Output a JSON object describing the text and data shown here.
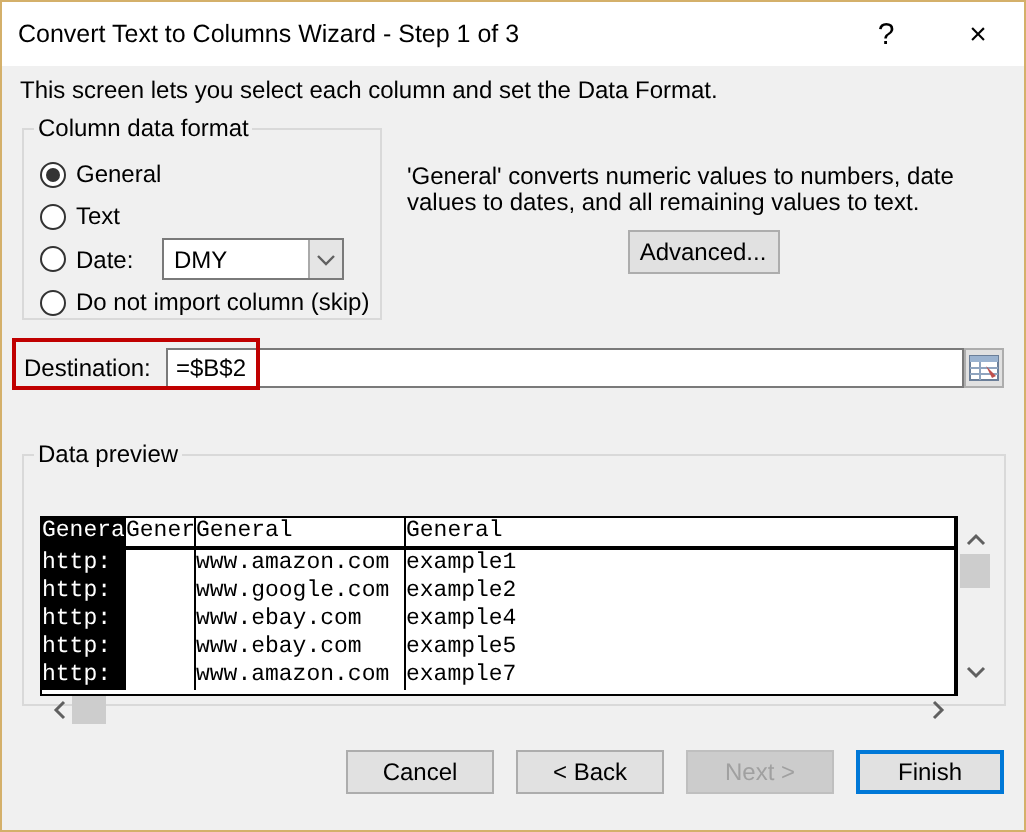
{
  "window": {
    "title": "Convert Text to Columns Wizard - Step 1 of 3",
    "help": "?",
    "close": "×"
  },
  "intro": "This screen lets you select each column and set the Data Format.",
  "format_group": {
    "title": "Column data format",
    "options": [
      {
        "label": "General",
        "selected": true
      },
      {
        "label": "Text",
        "selected": false
      },
      {
        "label": "Date:",
        "selected": false,
        "kind": "dropdown",
        "value": "DMY"
      },
      {
        "label": "Do not import column (skip)",
        "selected": false
      }
    ]
  },
  "description": "'General' converts numeric values to numbers, date values to dates, and all remaining values to text.",
  "advanced_button": "Advanced...",
  "destination": {
    "label": "Destination:",
    "value": "=$B$2",
    "highlighted": true
  },
  "preview": {
    "title": "Data preview",
    "columns": [
      {
        "header": "Genera",
        "selected": true
      },
      {
        "header": "Gener",
        "selected": false
      },
      {
        "header": "General",
        "selected": false
      },
      {
        "header": "General",
        "selected": false
      }
    ],
    "rows": [
      [
        "http:",
        null,
        "www.amazon.com",
        "example1"
      ],
      [
        "http:",
        null,
        "www.google.com",
        "example2"
      ],
      [
        "http:",
        null,
        "www.ebay.com",
        "example4"
      ],
      [
        "http:",
        null,
        "www.ebay.com",
        "example5"
      ],
      [
        "http:",
        null,
        "www.amazon.com",
        "example7"
      ]
    ]
  },
  "buttons": [
    {
      "label": "Cancel",
      "disabled": false,
      "default": false
    },
    {
      "label": "< Back",
      "disabled": false,
      "default": false
    },
    {
      "label": "Next >",
      "disabled": true,
      "default": false
    },
    {
      "label": "Finish",
      "disabled": false,
      "default": true
    }
  ]
}
